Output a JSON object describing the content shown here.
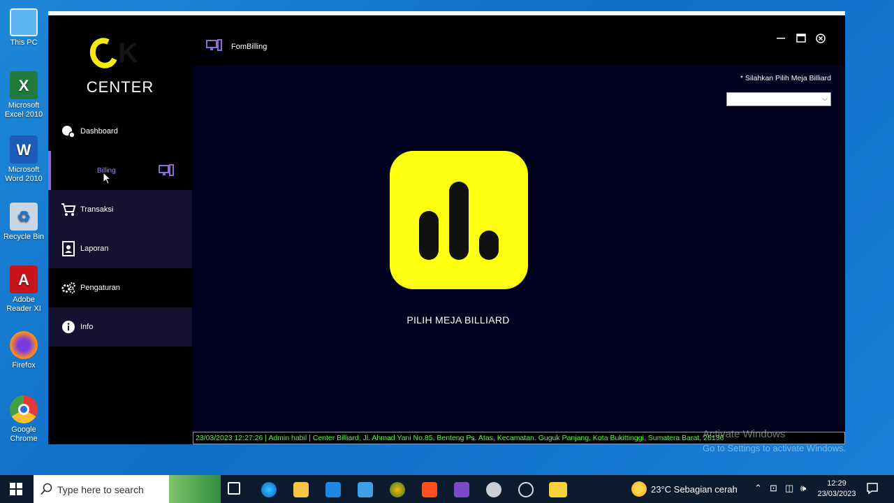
{
  "desktop": {
    "icons": [
      {
        "label": "This PC"
      },
      {
        "label": "Microsoft Excel 2010"
      },
      {
        "label": "Microsoft Word 2010"
      },
      {
        "label": "Recycle Bin"
      },
      {
        "label": "Adobe Reader XI"
      },
      {
        "label": "Firefox"
      },
      {
        "label": "Google Chrome"
      }
    ]
  },
  "app": {
    "logo_text": "CENTER",
    "window_title": "FomBilling",
    "sidebar": {
      "items": [
        {
          "label": "Dashboard"
        },
        {
          "label": "Billing"
        },
        {
          "label": "Transaksi"
        },
        {
          "label": "Laporan"
        },
        {
          "label": "Pengaturan"
        },
        {
          "label": "Info"
        }
      ]
    },
    "main": {
      "hint": "* Silahkan Pilih Meja Billiard",
      "dropdown_value": "",
      "center_label": "PILIH MEJA BILLIARD"
    },
    "status_bar": "23/03/2023 12:27:26  |  Admin  habil  |   Center Billiard, Jl. Ahmad Yani No.85, Benteng Ps. Atas, Kecamatan. Guguk Panjang, Kota Bukittinggi, Sumatera Barat, 26136"
  },
  "watermark": {
    "line1": "Activate Windows",
    "line2": "Go to Settings to activate Windows."
  },
  "taskbar": {
    "search_placeholder": "Type here to search",
    "weather": "23°C  Sebagian cerah",
    "time": "12:29",
    "date": "23/03/2023"
  },
  "colors": {
    "accent_yellow": "#ffff10",
    "accent_purple": "#8f6ad9",
    "status_green": "#4dff2e",
    "main_bg": "#02021f"
  }
}
